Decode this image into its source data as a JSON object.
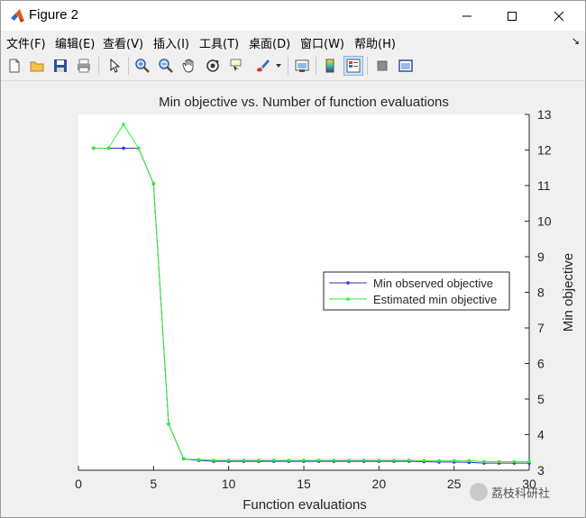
{
  "window": {
    "title": "Figure 2"
  },
  "menu": {
    "items": [
      "文件(F)",
      "编辑(E)",
      "查看(V)",
      "插入(I)",
      "工具(T)",
      "桌面(D)",
      "窗口(W)",
      "帮助(H)"
    ],
    "overflow_arrow": "↘"
  },
  "toolbar": {
    "icons": [
      "new-figure-icon",
      "open-file-icon",
      "save-icon",
      "print-icon",
      "pointer-icon",
      "zoom-in-icon",
      "zoom-out-icon",
      "pan-hand-icon",
      "rotate-3d-icon",
      "data-cursor-icon",
      "brush-icon",
      "brush-dropdown-icon",
      "link-plot-icon",
      "insert-colorbar-icon",
      "insert-legend-icon",
      "hide-plot-tools-icon",
      "show-plot-tools-icon"
    ]
  },
  "colors": {
    "observed": "#3232d2",
    "estimated": "#2ef02e",
    "axes_bg": "#ffffff",
    "figure_bg": "#f0f0f0"
  },
  "watermark": {
    "text": "荔枝科研社"
  },
  "chart_data": {
    "type": "line",
    "title": "Min objective vs. Number of function evaluations",
    "xlabel": "Function evaluations",
    "ylabel": "Min objective",
    "xlim": [
      0,
      30
    ],
    "ylim": [
      3,
      13
    ],
    "xticks": [
      0,
      5,
      10,
      15,
      20,
      25,
      30
    ],
    "yticks": [
      3,
      4,
      5,
      6,
      7,
      8,
      9,
      10,
      11,
      12,
      13
    ],
    "y_axis_location": "right",
    "grid": false,
    "legend_placement": "east",
    "series": [
      {
        "name": "Min observed objective",
        "color": "#3232d2",
        "x": [
          1,
          2,
          3,
          4,
          5,
          6,
          7,
          8,
          9,
          10,
          11,
          12,
          13,
          14,
          15,
          16,
          17,
          18,
          19,
          20,
          21,
          22,
          23,
          24,
          25,
          26,
          27,
          28,
          29,
          30
        ],
        "y": [
          12.05,
          12.05,
          12.05,
          12.05,
          11.05,
          4.3,
          3.32,
          3.28,
          3.25,
          3.25,
          3.25,
          3.25,
          3.25,
          3.25,
          3.25,
          3.25,
          3.25,
          3.25,
          3.25,
          3.25,
          3.25,
          3.25,
          3.24,
          3.23,
          3.23,
          3.22,
          3.2,
          3.2,
          3.2,
          3.2
        ]
      },
      {
        "name": "Estimated min objective",
        "color": "#2ef02e",
        "x": [
          1,
          2,
          3,
          4,
          5,
          6,
          7,
          8,
          9,
          10,
          11,
          12,
          13,
          14,
          15,
          16,
          17,
          18,
          19,
          20,
          21,
          22,
          23,
          24,
          25,
          26,
          27,
          28,
          29,
          30
        ],
        "y": [
          12.05,
          12.05,
          12.72,
          12.05,
          11.05,
          4.3,
          3.32,
          3.3,
          3.28,
          3.28,
          3.28,
          3.28,
          3.28,
          3.28,
          3.28,
          3.28,
          3.28,
          3.28,
          3.28,
          3.28,
          3.28,
          3.28,
          3.27,
          3.27,
          3.27,
          3.27,
          3.24,
          3.24,
          3.24,
          3.24
        ]
      }
    ]
  }
}
